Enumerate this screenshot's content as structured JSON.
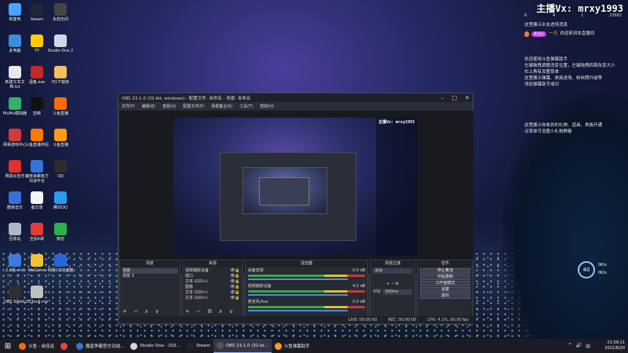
{
  "desktop": {
    "icons": [
      {
        "label": "新建电",
        "color": "#4aa3ff"
      },
      {
        "label": "Steam",
        "color": "#1b2838"
      },
      {
        "label": "永劫无间",
        "color": "#444"
      },
      {
        "label": "此电脑",
        "color": "#3c8dde"
      },
      {
        "label": "YY",
        "color": "#ffcc00"
      },
      {
        "label": "Studio One 2",
        "color": "#cfd7e6"
      },
      {
        "label": "新建文本文档.txt",
        "color": "#e8e8e8"
      },
      {
        "label": "酒鬼.exe",
        "color": "#c22a2a"
      },
      {
        "label": "EG下载库",
        "color": "#f0c060"
      },
      {
        "label": "MuMu模拟器",
        "color": "#2fb36a"
      },
      {
        "label": "剪映",
        "color": "#111"
      },
      {
        "label": "斗鱼直播",
        "color": "#ff6a00"
      },
      {
        "label": "网易游戏中心",
        "color": "#d23a3a"
      },
      {
        "label": "斗鱼直播伴侣",
        "color": "#ff7a00"
      },
      {
        "label": "斗鱼直播",
        "color": "#ff9a1a"
      },
      {
        "label": "网易云音乐",
        "color": "#e0302c"
      },
      {
        "label": "魔兽争霸官方对战平台",
        "color": "#3574d8"
      },
      {
        "label": "QQ",
        "color": "#2d2d2d"
      },
      {
        "label": "酷我音乐",
        "color": "#3a6fd8"
      },
      {
        "label": "备忘录",
        "color": "#f6f6f6"
      },
      {
        "label": "腾讯QQ",
        "color": "#2a9cf0"
      },
      {
        "label": "回收站",
        "color": "#b0b8c8"
      },
      {
        "label": "全民K歌",
        "color": "#e53b3b"
      },
      {
        "label": "微信",
        "color": "#2bb24c"
      },
      {
        "label": "2.0版.mid",
        "color": "#3d7ae0"
      },
      {
        "label": "WeGame",
        "color": "#f1c232"
      },
      {
        "label": "网易UU加速器",
        "color": "#2866d6"
      },
      {
        "label": "OBS Studio",
        "color": "#302e31"
      },
      {
        "label": "233acg.mo",
        "color": "#c0c0c0"
      }
    ]
  },
  "overlay": {
    "streamer": "主播Vx: mrxy1993",
    "stats": [
      "6",
      "4",
      "1",
      "23682"
    ],
    "chat": [
      {
        "type": "text",
        "text": "这里展示水友进场消息"
      },
      {
        "type": "gift",
        "badge": "粉丝1",
        "name": "一凡",
        "text": "欢迎来到本直播间"
      },
      {
        "type": "spacer"
      },
      {
        "type": "text",
        "text": "欢迎使用斗鱼弹幕助手"
      },
      {
        "type": "text",
        "text": "左键拖拽调整改变位置，左键拖拽四周改变大小"
      },
      {
        "type": "text",
        "text": "右上角有设置菜单"
      },
      {
        "type": "text",
        "text": "这里展示弹幕、贵族进场、粉丝牌升级等"
      },
      {
        "type": "text",
        "text": "添加弹幕助手成功"
      },
      {
        "type": "spacer"
      },
      {
        "type": "spacer"
      },
      {
        "type": "text",
        "text": "这里展示你收到的礼物、道具、贵族开通"
      },
      {
        "type": "text",
        "text": "点菜单可设置小礼物屏蔽"
      }
    ],
    "gauge": "40",
    "gauge_up": "0K/s",
    "gauge_down": "0K/s"
  },
  "obs": {
    "title": "OBS 23.1.0 (32-bit, windows) - 配置文件: 未命名 - 场景: 未命名",
    "menu": [
      "文件(F)",
      "编辑(E)",
      "查看(V)",
      "配置文件(P)",
      "场景集合(S)",
      "工具(T)",
      "帮助(H)"
    ],
    "nested_streamer": "主播Vx: mrxy1993",
    "docks": {
      "scenes": {
        "header": "场景",
        "items": [
          "场景",
          "场景 2"
        ]
      },
      "sources": {
        "header": "来源",
        "items": [
          "视频捕获设备",
          "窗口",
          "文本 (GDI+)",
          "图像",
          "文本 (GDI+)",
          "文本 (GDI+)"
        ]
      },
      "mixer": {
        "header": "混音器",
        "channels": [
          {
            "name": "桌面音频",
            "db": "0.0 dB"
          },
          {
            "name": "视频捕获设备",
            "db": "-4.5 dB"
          },
          {
            "name": "麦克风/Aux",
            "db": "0.0 dB"
          }
        ]
      },
      "transitions": {
        "header": "场景过渡",
        "type": "淡出",
        "duration_label": "时长",
        "duration": "300ms"
      },
      "controls": {
        "header": "控件",
        "buttons": [
          "停止推流",
          "开始录制",
          "工作室模式",
          "设置",
          "退出"
        ]
      }
    },
    "status": {
      "live": "LIVE: 00:00:00",
      "rec": "REC: 00:00:00",
      "cpu": "CPU: 4.1%, 60.00 fps"
    }
  },
  "taskbar": {
    "items": [
      {
        "label": "斗鱼 - 余佳运",
        "color": "#ff6a00",
        "active": false
      },
      {
        "label": "",
        "color": "#e8453c",
        "active": false
      },
      {
        "label": "魔兽争霸官方对战...",
        "color": "#3574d8",
        "active": false
      },
      {
        "label": "Studio One - 202...",
        "color": "#cfd7e6",
        "active": false
      },
      {
        "label": "Steam",
        "color": "#1b2838",
        "active": false
      },
      {
        "label": "OBS 23.1.0 (32-bi...",
        "color": "#555",
        "active": true
      },
      {
        "label": "斗鱼弹幕助手",
        "color": "#ff9a1a",
        "active": false
      }
    ],
    "time": "21:09:11",
    "date": "2021/8/20",
    "tray": [
      "^",
      "🔊",
      "中"
    ]
  }
}
